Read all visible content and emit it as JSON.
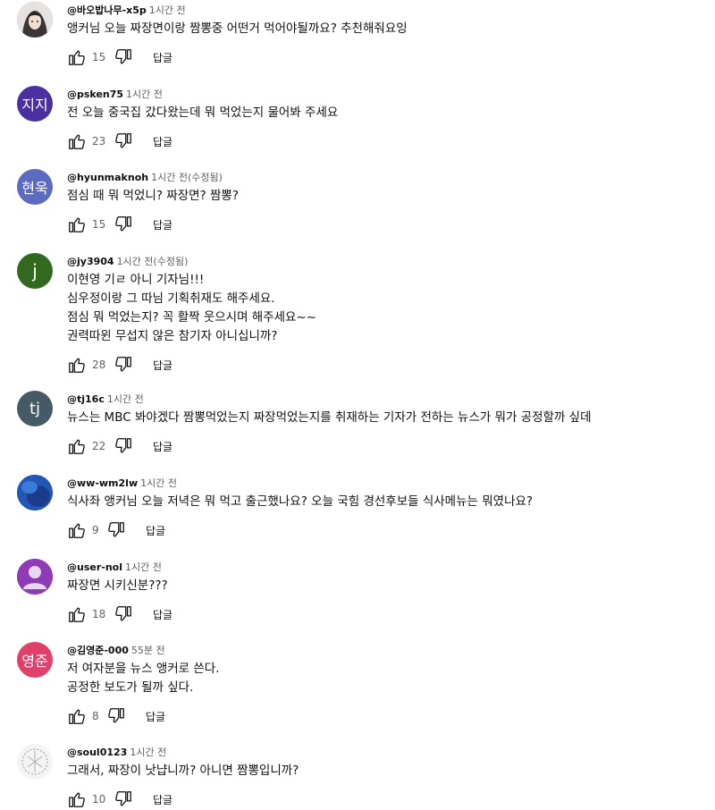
{
  "comments": [
    {
      "author": "@바오밥나무-x5p",
      "time": "1시간 전",
      "text": "앵커님 오늘 짜장면이랑 짬뽕중 어떤거 먹어야될까요? 추천해줘요잉",
      "likes": "15",
      "reply": "답글",
      "avatar_text": "",
      "avatar_color": "#7a6a6a"
    },
    {
      "author": "@psken75",
      "time": "1시간 전",
      "text": "전 오늘 중국집 갔다왔는데 뭐 먹었는지 물어봐 주세요",
      "likes": "23",
      "reply": "답글",
      "avatar_text": "지지",
      "avatar_color": "#4a2fa0"
    },
    {
      "author": "@hyunmaknoh",
      "time": "1시간 전(수정됨)",
      "text": "점심 때 뭐 먹었니? 짜장면? 짬뽕?",
      "likes": "15",
      "reply": "답글",
      "avatar_text": "현욱",
      "avatar_color": "#5c6bc0"
    },
    {
      "author": "@jy3904",
      "time": "1시간 전(수정됨)",
      "text": "이현영 기ㄹ 아니 기자님!!!\n심우정이랑 그 따님 기획취재도 해주세요.\n점심 뭐 먹었는지? 꼭 활짝 웃으시며 해주세요~~\n권력따윈 무섭지 않은 참기자 아니십니까?",
      "likes": "28",
      "reply": "답글",
      "avatar_text": "j",
      "avatar_color": "#33691e"
    },
    {
      "author": "@tj16c",
      "time": "1시간 전",
      "text": "뉴스는 MBC 봐야겠다 짬뽕먹었는지 짜장먹었는지를 취재하는 기자가 전하는 뉴스가 뭐가 공정할까 싶데",
      "likes": "22",
      "reply": "답글",
      "avatar_text": "tj",
      "avatar_color": "#455a64"
    },
    {
      "author": "@ww-wm2lw",
      "time": "1시간 전",
      "text": "식사좌 앵커님 오늘 저녁은 뭐 먹고 출근했나요? 오늘 국힘 경선후보들 식사메뉴는 뭐였나요?",
      "likes": "9",
      "reply": "답글",
      "avatar_text": "",
      "avatar_color": "#2a5bb0"
    },
    {
      "author": "@user-nol",
      "time": "1시간 전",
      "text": "짜장면 시키신분???",
      "likes": "18",
      "reply": "답글",
      "avatar_text": "",
      "avatar_color": "#8e3bb5"
    },
    {
      "author": "@김영준-000",
      "time": "55분 전",
      "text": "저 여자분을 뉴스 앵커로 쓴다.\n공정한 보도가 될까 싶다.",
      "likes": "8",
      "reply": "답글",
      "avatar_text": "영준",
      "avatar_color": "#e0406a"
    },
    {
      "author": "@soul0123",
      "time": "1시간 전",
      "text": "그래서, 짜장이 낫냡니까? 아니면 짬뽕입니까?",
      "likes": "10",
      "reply": "답글",
      "avatar_text": "",
      "avatar_color": "#e8e8e8"
    }
  ]
}
